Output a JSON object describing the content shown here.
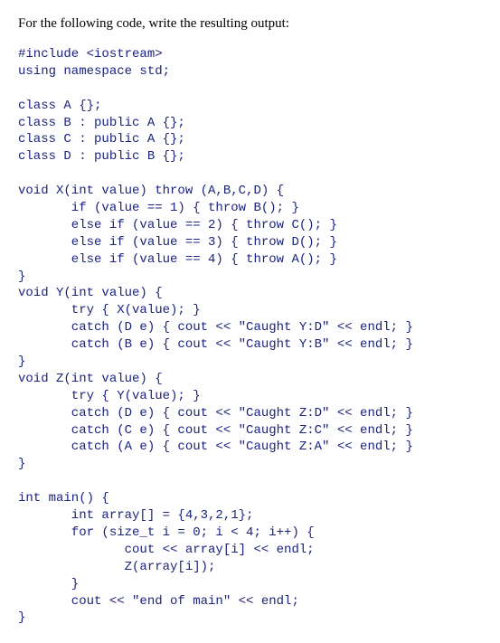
{
  "prompt": "For the following code, write the resulting output:",
  "code": "#include <iostream>\nusing namespace std;\n\nclass A {};\nclass B : public A {};\nclass C : public A {};\nclass D : public B {};\n\nvoid X(int value) throw (A,B,C,D) {\n       if (value == 1) { throw B(); }\n       else if (value == 2) { throw C(); }\n       else if (value == 3) { throw D(); }\n       else if (value == 4) { throw A(); }\n}\nvoid Y(int value) {\n       try { X(value); }\n       catch (D e) { cout << \"Caught Y:D\" << endl; }\n       catch (B e) { cout << \"Caught Y:B\" << endl; }\n}\nvoid Z(int value) {\n       try { Y(value); }\n       catch (D e) { cout << \"Caught Z:D\" << endl; }\n       catch (C e) { cout << \"Caught Z:C\" << endl; }\n       catch (A e) { cout << \"Caught Z:A\" << endl; }\n}\n\nint main() {\n       int array[] = {4,3,2,1};\n       for (size_t i = 0; i < 4; i++) {\n              cout << array[i] << endl;\n              Z(array[i]);\n       }\n       cout << \"end of main\" << endl;\n}"
}
